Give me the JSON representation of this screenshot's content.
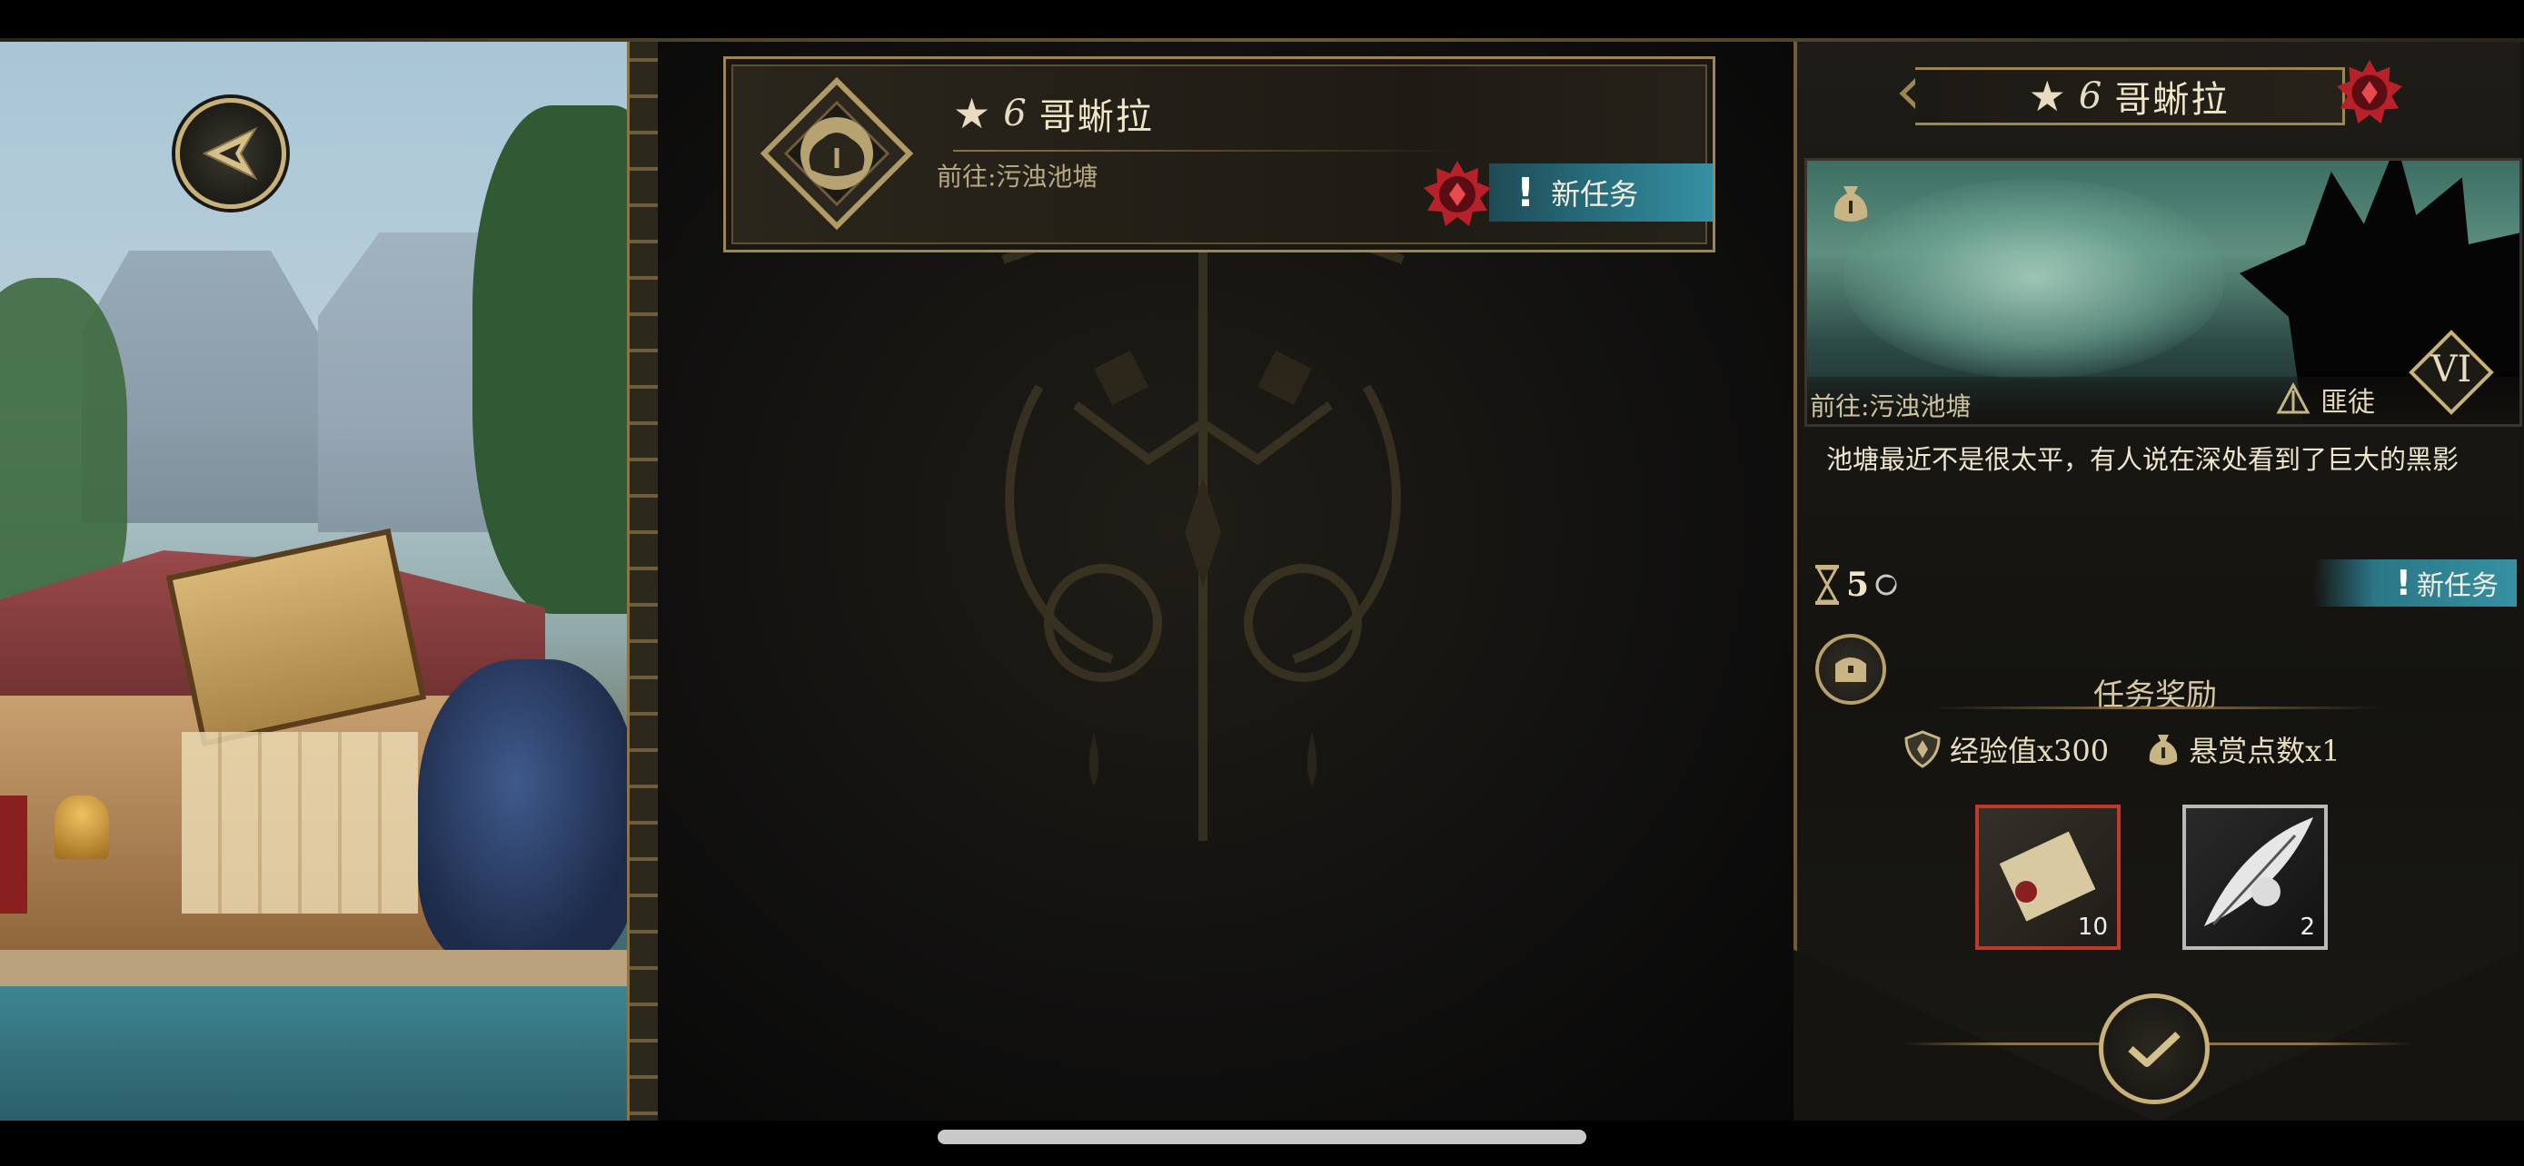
{
  "quest": {
    "star": "★",
    "level": "6",
    "name": "哥蜥拉",
    "destination": "前往:污浊池塘",
    "tag": "新任务",
    "tag_mark": "!"
  },
  "detail": {
    "star": "★",
    "level": "6",
    "name": "哥蜥拉",
    "destination": "前往:污浊池塘",
    "role": "匪徒",
    "rank": "VI",
    "description": "池塘最近不是很太平，有人说在深处看到了巨大的黑影",
    "time_value": "5",
    "status_tag": "新任务",
    "status_mark": "!",
    "reward_title": "任务奖励",
    "rewards": [
      {
        "label": "经验值x300",
        "icon": "shield-icon"
      },
      {
        "label": "悬赏点数x1",
        "icon": "money-bag-icon"
      }
    ],
    "items": [
      {
        "count": "10",
        "icon": "scroll-icon",
        "rarity_color": "#c0392b"
      },
      {
        "count": "2",
        "icon": "feather-icon",
        "rarity_color": "#b9b9b9"
      }
    ]
  },
  "colors": {
    "gold": "#c8b27a",
    "teal_tag": "#2a7686",
    "red_mark": "#c0222a"
  }
}
